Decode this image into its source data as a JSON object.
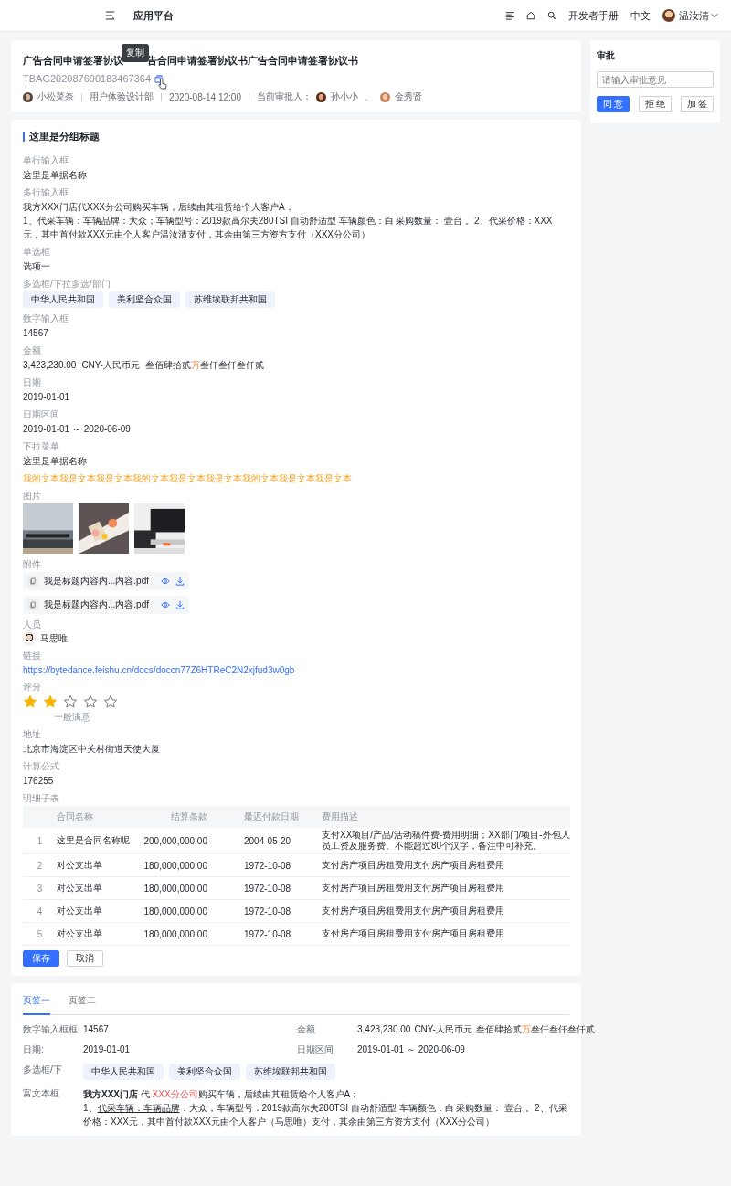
{
  "header": {
    "app_title": "应用平台",
    "links": [
      "开发者手册",
      "中文"
    ],
    "user": "温汝清"
  },
  "document": {
    "title_parts": [
      "广告合同申请签署协议",
      "告合同申请签署协议书广告合同申请签署协议书"
    ],
    "tooltip": "复制",
    "code": "TBAG202087690183467364",
    "author": "小松菜奈",
    "department": "用户体验设计部",
    "time": "2020-08-14 12:00",
    "approvers_label": "当前审批人：",
    "approvers": [
      "孙小小",
      "金秀贤"
    ],
    "approver_separator": "、"
  },
  "approval": {
    "title": "审批",
    "placeholder": "请输入审批意见",
    "buttons": [
      {
        "label": "同 意",
        "kind": "primary"
      },
      {
        "label": "拒 绝",
        "kind": "default"
      },
      {
        "label": "加 签",
        "kind": "default"
      }
    ]
  },
  "group": {
    "title": "这里是分组标题",
    "fields": [
      {
        "kind": "text",
        "label": "单行输入框",
        "value": "这里是单据名称"
      },
      {
        "kind": "text",
        "label": "多行输入框",
        "value": "我方XXX门店代XXX分公司购买车辆，后续由其租赁给个人客户A；\n1、代采车辆：车辆品牌：大众；车辆型号：2019款高尔夫280TSI 自动舒适型  车辆颜色：白  采购数量：  壹台 。2、代采价格：XXX元，其中首付款XXX元由个人客户温汝清支付，其余由第三方资方支付（XXX分公司）"
      },
      {
        "kind": "text",
        "label": "单选框",
        "value": "选项一"
      },
      {
        "kind": "tags",
        "label": "多选框/下拉多选/部门",
        "tags": [
          "中华人民共和国",
          "美利坚合众国",
          "苏维埃联邦共和国"
        ]
      },
      {
        "kind": "text",
        "label": "数字输入框",
        "value": "14567"
      },
      {
        "kind": "amount",
        "label": "金额",
        "amount": "3,423,230.00",
        "currency": "CNY-人民币元",
        "words": [
          {
            "text": "叁佰肆拾贰",
            "kind": "plain"
          },
          {
            "text": "万",
            "kind": "accent"
          },
          {
            "text": "叁仟叁仟叁仟贰",
            "kind": "plain"
          }
        ]
      },
      {
        "kind": "text",
        "label": "日期",
        "value": "2019-01-01"
      },
      {
        "kind": "text",
        "label": "日期区间",
        "value": "2019-01-01 ～ 2020-06-09"
      },
      {
        "kind": "text",
        "label": "下拉菜单",
        "value": "这里是单据名称"
      },
      {
        "kind": "note",
        "value": "我的文本我是文本我是文本我的文本我是文本我是文本我的文本我是文本我是文本"
      },
      {
        "kind": "images",
        "label": "图片"
      },
      {
        "kind": "files",
        "label": "附件",
        "files": [
          "我是标题内容内...内容.pdf",
          "我是标题内容内...内容.pdf"
        ]
      },
      {
        "kind": "person",
        "label": "人员",
        "name": "马思唯"
      },
      {
        "kind": "link",
        "label": "链接",
        "url": "https://bytedance.feishu.cn/docs/doccn77Z6HTReC2N2xjfud3w0gb"
      },
      {
        "kind": "rating",
        "label": "评分",
        "stars": 2,
        "caption": "一般满意"
      },
      {
        "kind": "text",
        "label": "地址",
        "value": "北京市海淀区中关村街道天使大厦"
      },
      {
        "kind": "text",
        "label": "计算公式",
        "value": "176255"
      },
      {
        "kind": "table",
        "label": "明细子表",
        "columns": [
          "合同名称",
          "结算条款",
          "最迟付款日期",
          "费用描述"
        ],
        "rows": [
          {
            "index": "1",
            "cells": [
              "这里是合同名称呢",
              "200,000,000.00",
              "2004-05-20",
              "支付XX项目/产品/活动稿件费-费用明细；XX部门/项目-外包人员工资及服务费。不能超过80个汉字，备注中可补充。"
            ]
          },
          {
            "index": "2",
            "cells": [
              "对公支出单",
              "180,000,000.00",
              "1972-10-08",
              "支付房产项目房租费用支付房产项目房租费用"
            ]
          },
          {
            "index": "3",
            "cells": [
              "对公支出单",
              "180,000,000.00",
              "1972-10-08",
              "支付房产项目房租费用支付房产项目房租费用"
            ]
          },
          {
            "index": "4",
            "cells": [
              "对公支出单",
              "180,000,000.00",
              "1972-10-08",
              "支付房产项目房租费用支付房产项目房租费用"
            ]
          },
          {
            "index": "5",
            "cells": [
              "对公支出单",
              "180,000,000.00",
              "1972-10-08",
              "支付房产项目房租费用支付房产项目房租费用"
            ]
          }
        ]
      }
    ],
    "actions": [
      {
        "label": "保存",
        "kind": "primary"
      },
      {
        "label": "取消",
        "kind": "default"
      }
    ]
  },
  "tabs": [
    {
      "label": "页签一",
      "selected": true
    },
    {
      "label": "页签二",
      "selected": false
    }
  ],
  "details": [
    {
      "kind": "text",
      "label": "数字输入框框",
      "value": "14567"
    },
    {
      "kind": "amount",
      "label": "金额",
      "amount": "3,423,230.00",
      "currency": "CNY-人民币元",
      "words": [
        {
          "text": "叁佰肆拾贰",
          "kind": "plain"
        },
        {
          "text": "万",
          "kind": "accent"
        },
        {
          "text": "叁仟叁仟叁仟贰",
          "kind": "plain"
        }
      ]
    },
    {
      "kind": "text",
      "label": "日期:",
      "value": "2019-01-01"
    },
    {
      "kind": "text",
      "label": "日期区间",
      "value": "2019-01-01 ～ 2020-06-09"
    },
    {
      "kind": "tags",
      "label": "多选框/下",
      "tags": [
        "中华人民共和国",
        "美利坚合众国",
        "苏维埃联邦共和国"
      ]
    },
    {
      "kind": "rich",
      "label": "富文本框",
      "lines": [
        [
          {
            "text": "我方XXX门店",
            "kind": "bold"
          },
          {
            "text": " 代 ",
            "kind": "plain"
          },
          {
            "text": "XXX分公司",
            "kind": "red"
          },
          {
            "text": "购买车辆，后续由其租赁给个人客户A；",
            "kind": "plain"
          }
        ],
        [
          {
            "text": "1、",
            "kind": "plain"
          },
          {
            "text": "代采车辆：车辆品牌",
            "kind": "underline"
          },
          {
            "text": "：大众；车辆型号：2019款高尔夫280TSI 自动舒适型  车辆颜色：白  采购数量：  壹台 。2、代采价格：XXX元，其中首付款XXX元由个人客户（马思唯）支付，其余由第三方资方支付（XXX分公司）",
            "kind": "plain"
          }
        ]
      ]
    }
  ]
}
